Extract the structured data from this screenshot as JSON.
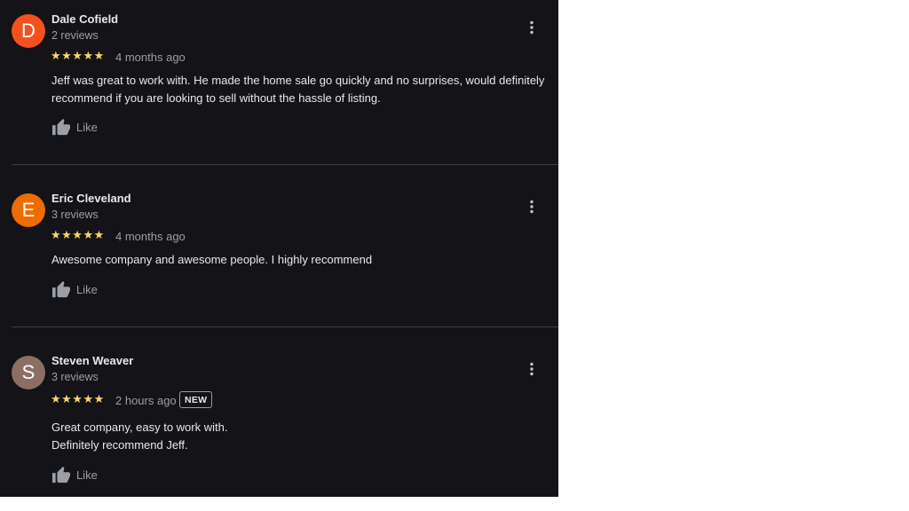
{
  "reviews": [
    {
      "avatar_letter": "D",
      "avatar_color": "#f4511e",
      "name": "Dale Cofield",
      "review_count": "2 reviews",
      "rating": 5,
      "stars": "★★★★★",
      "time": "4 months ago",
      "badge": "",
      "text_lines": [
        "Jeff was great to work with. He made the home sale go quickly and no surprises, would definitely",
        "recommend if you are looking to sell without the hassle of listing."
      ],
      "like_label": "Like"
    },
    {
      "avatar_letter": "E",
      "avatar_color": "#ef6c00",
      "name": "Eric Cleveland",
      "review_count": "3 reviews",
      "rating": 5,
      "stars": "★★★★★",
      "time": "4 months ago",
      "badge": "",
      "text_lines": [
        "Awesome company and awesome people. I highly recommend"
      ],
      "like_label": "Like"
    },
    {
      "avatar_letter": "S",
      "avatar_color": "#8d6e63",
      "name": "Steven Weaver",
      "review_count": "3 reviews",
      "rating": 5,
      "stars": "★★★★★",
      "time": "2 hours ago",
      "badge": "NEW",
      "text_lines": [
        "Great company, easy to work with.",
        "Definitely recommend Jeff."
      ],
      "like_label": "Like"
    }
  ],
  "icons": {
    "more": "more-vert-icon",
    "like": "thumbs-up-icon"
  }
}
